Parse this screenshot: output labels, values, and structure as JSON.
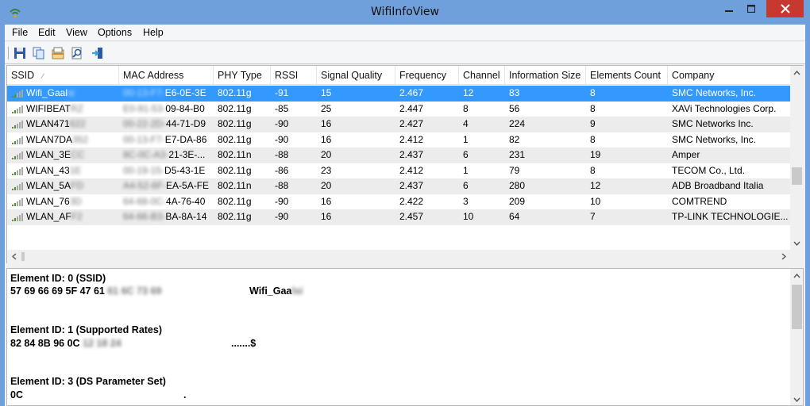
{
  "window": {
    "title": "WifiInfoView"
  },
  "menu": [
    "File",
    "Edit",
    "View",
    "Options",
    "Help"
  ],
  "toolbar": {
    "icons": [
      "save-icon",
      "copy-icon",
      "properties-icon",
      "find-icon",
      "exit-icon"
    ]
  },
  "columns": [
    "SSID",
    "MAC Address",
    "PHY Type",
    "RSSI",
    "Signal Quality",
    "Frequency",
    "Channel",
    "Information Size",
    "Elements Count",
    "Company"
  ],
  "rows": [
    {
      "ssid": "Wifi_Gaal",
      "ssid_hidden": "si",
      "mac_hidden": "00-13-F7-",
      "mac": "E6-0E-3E",
      "phy": "802.11g",
      "rssi": "-91",
      "quality": "15",
      "freq": "2.467",
      "channel": "12",
      "info": "83",
      "elements": "8",
      "company": "SMC Networks, Inc.",
      "selected": true
    },
    {
      "ssid": "WIFIBEAT",
      "ssid_hidden": "RZ",
      "mac_hidden": "E0-91-53-",
      "mac": "09-84-B0",
      "phy": "802.11g",
      "rssi": "-85",
      "quality": "25",
      "freq": "2.447",
      "channel": "8",
      "info": "56",
      "elements": "8",
      "company": "XAVi Technologies Corp."
    },
    {
      "ssid": "WLAN471",
      "ssid_hidden": "622",
      "mac_hidden": "00-22-2D-",
      "mac": "44-71-D9",
      "phy": "802.11g",
      "rssi": "-90",
      "quality": "16",
      "freq": "2.427",
      "channel": "4",
      "info": "224",
      "elements": "9",
      "company": "SMC Networks Inc."
    },
    {
      "ssid": "WLAN7DA",
      "ssid_hidden": "352",
      "mac_hidden": "00-13-F7-",
      "mac": "E7-DA-86",
      "phy": "802.11g",
      "rssi": "-90",
      "quality": "16",
      "freq": "2.412",
      "channel": "1",
      "info": "82",
      "elements": "8",
      "company": "SMC Networks, Inc."
    },
    {
      "ssid": "WLAN_3E",
      "ssid_hidden": "CC",
      "mac_hidden": "8C-0C-A3-",
      "mac": "21-3E-...",
      "phy": "802.11n",
      "rssi": "-88",
      "quality": "20",
      "freq": "2.437",
      "channel": "6",
      "info": "231",
      "elements": "19",
      "company": "Amper"
    },
    {
      "ssid": "WLAN_43",
      "ssid_hidden": "1E",
      "mac_hidden": "00-19-15-",
      "mac": "D5-43-1E",
      "phy": "802.11g",
      "rssi": "-86",
      "quality": "23",
      "freq": "2.412",
      "channel": "1",
      "info": "79",
      "elements": "8",
      "company": "TECOM Co., Ltd."
    },
    {
      "ssid": "WLAN_5A",
      "ssid_hidden": "FD",
      "mac_hidden": "A4-52-6F-",
      "mac": "EA-5A-FE",
      "phy": "802.11n",
      "rssi": "-88",
      "quality": "20",
      "freq": "2.437",
      "channel": "6",
      "info": "280",
      "elements": "12",
      "company": "ADB Broadband Italia"
    },
    {
      "ssid": "WLAN_76",
      "ssid_hidden": "3D",
      "mac_hidden": "64-68-0C-",
      "mac": "4A-76-40",
      "phy": "802.11g",
      "rssi": "-90",
      "quality": "16",
      "freq": "2.422",
      "channel": "3",
      "info": "209",
      "elements": "10",
      "company": "COMTREND"
    },
    {
      "ssid": "WLAN_AF",
      "ssid_hidden": "F2",
      "mac_hidden": "64-66-B3-",
      "mac": "BA-8A-14",
      "phy": "802.11g",
      "rssi": "-90",
      "quality": "16",
      "freq": "2.457",
      "channel": "10",
      "info": "64",
      "elements": "7",
      "company": "TP-LINK TECHNOLOGIE..."
    }
  ],
  "details": [
    {
      "header": "Element ID: 0  (SSID)",
      "hex": "57 69 66 69 5F 47 61",
      "hex_hidden": "61 6C 73 69",
      "ascii": "Wifi_Gaa",
      "ascii_hidden": "lsi"
    },
    {
      "header": "Element ID: 1  (Supported Rates)",
      "hex": "82 84 8B 96 0C",
      "hex_hidden": "12 18 24",
      "ascii": ".......$",
      "ascii_hidden": ""
    },
    {
      "header": "Element ID: 3  (DS Parameter Set)",
      "hex": "0C",
      "hex_hidden": "",
      "ascii": ".",
      "ascii_hidden": ""
    }
  ],
  "colors": {
    "titlebar": "#6fa0dc",
    "selection": "#3399ff",
    "close_button": "#c7392e",
    "alt_row": "#ececec"
  }
}
